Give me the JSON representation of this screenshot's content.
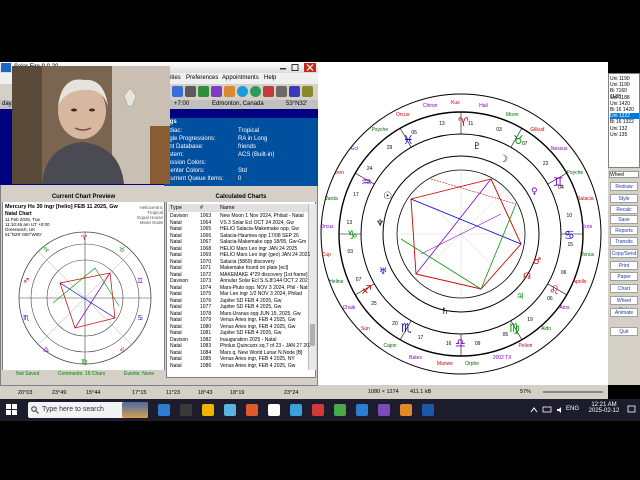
{
  "left_app": {
    "title": "Solar Fire 9.0.20",
    "menus": [
      "File",
      "Chart",
      "Interps",
      "Points",
      "Reports",
      "Utilities",
      "Preferences",
      "Appointments",
      "Help"
    ],
    "visible_menus": [
      "ities",
      "Preferences",
      "Appointments",
      "Help"
    ],
    "info_bar": {
      "day": "day,",
      "time": "+7:00",
      "place": "Edmonton, Canada",
      "coords": "53°N32' 113°"
    },
    "settings_header": "ngs",
    "settings": [
      {
        "label": "odiac:",
        "value": "Tropical"
      },
      {
        "label": "ngle Progressions:",
        "value": "RA in Long"
      },
      {
        "label": "ent Database:",
        "value": "friends"
      },
      {
        "label": "ystem:",
        "value": "ACS (Built-in)"
      },
      {
        "label": "ression Colors:",
        "value": ""
      },
      {
        "label": "Center Colors:",
        "value": "Std"
      },
      {
        "label": "Current Queue Items:",
        "value": "0"
      }
    ]
  },
  "preview": {
    "header": "Current Chart Preview",
    "chart_title": "Mercury Hs 30 ingr [helio] FEB 11 2025, Gw",
    "subtitle": "Natal Chart",
    "details": [
      "11 Feb 2025, Tue",
      "11:10:46 am UT +0:00",
      "Greenwich, UK",
      "51°N29' 000°W00'",
      "Geocentric",
      "Tropical",
      "Koch",
      "Mean Node"
    ],
    "right_details": [
      "Heliocentric",
      "Tropical",
      "Equal House",
      "Mean Node"
    ],
    "status": {
      "not_saved": "Not Saved",
      "comments": "Comments: 15 Chars",
      "events": "Events: None"
    }
  },
  "calculated": {
    "header": "Calculated Charts",
    "col_type": "Type",
    "col_num": "#",
    "col_name": "Name",
    "rows": [
      {
        "type": "Davison",
        "num": "1063",
        "name": "New Moon 1 Nov 2024, Philad - Natal"
      },
      {
        "type": "Natal",
        "num": "1064",
        "name": "VS 3 Solar Ecl OCT 24 2024, Gw"
      },
      {
        "type": "Natal",
        "num": "1065",
        "name": "HELIO Salacia-Makemake opp, Gw"
      },
      {
        "type": "Natal",
        "num": "1066",
        "name": "Salacia-Haumea opp 17/08 SEP 26"
      },
      {
        "type": "Natal",
        "num": "1067",
        "name": "Salacia-Makemake opp 18/05, Gw-Gm"
      },
      {
        "type": "Natal",
        "num": "1068",
        "name": "HELIO Mars Leo ingr JAN 24 2025"
      },
      {
        "type": "Natal",
        "num": "1069",
        "name": "HELIO Mars Leo ingr (geo) JAN 24 2021"
      },
      {
        "type": "Natal",
        "num": "1070",
        "name": "Salacia (5869) discovery"
      },
      {
        "type": "Natal",
        "num": "1071",
        "name": "Makemake found on plate [ecl]"
      },
      {
        "type": "Natal",
        "num": "1072",
        "name": "MAKEMAKE 4*29 discovery [1st frame]"
      },
      {
        "type": "Davison",
        "num": "1073",
        "name": "Annular Solar Ecl S.S.8!144 OCT 2 202"
      },
      {
        "type": "Natal",
        "num": "1074",
        "name": "Mars-Pluto opp. NOV 3 2024, Phil - Nat"
      },
      {
        "type": "Natal",
        "num": "1075",
        "name": "Mar Leo ingr 1/2 NOV 3 2024, Philad"
      },
      {
        "type": "Natal",
        "num": "1076",
        "name": "Jupiter SD FEB 4 2025, Gw"
      },
      {
        "type": "Natal",
        "num": "1077",
        "name": "Jupiter SD FEB 4 2025, Gw"
      },
      {
        "type": "Natal",
        "num": "1078",
        "name": "Mars-Uranus sqq JUN 15, 2025, Gw"
      },
      {
        "type": "Natal",
        "num": "1079",
        "name": "Venus Aries ingr, FEB 4 2025, Gw"
      },
      {
        "type": "Natal",
        "num": "1080",
        "name": "Venus Aries ingr, FEB 4 2025, Gw"
      },
      {
        "type": "Natal",
        "num": "1081",
        "name": "Jupiter SD FEB 4 2025, Gw"
      },
      {
        "type": "Davison",
        "num": "1082",
        "name": "Inauguration 2025 - Natal"
      },
      {
        "type": "Natal",
        "num": "1083",
        "name": "Pholus Quincunx sq.7 of 23 - JAN 27 2025"
      },
      {
        "type": "Natal",
        "num": "1084",
        "name": "Mars q. New World Lunar N.Node [B]"
      },
      {
        "type": "Natal",
        "num": "1085",
        "name": "Venus Aries ingr, FEB 4 2025, NY"
      },
      {
        "type": "Natal",
        "num": "1086",
        "name": "Venus Aries ingr, FEB 4 2025, Gw"
      }
    ]
  },
  "left_status_planets": [
    "20°03",
    "23°49",
    "15°44",
    "17°15",
    "11°23",
    "18°43",
    "18°19",
    "23°24"
  ],
  "chart_window": {
    "bottom": {
      "dims": "1080 × 1274",
      "size": "411.1 kB",
      "zoom": "57%"
    },
    "outer_labels": [
      "Kus",
      "Hail",
      "Moon",
      "Gilkud",
      "Nessus",
      "Psyche",
      "Salacia",
      "Eros",
      "Venus",
      "Apollo",
      "Atos",
      "Aido",
      "Pelion",
      "2002 TX",
      "Orphe",
      "Manwe",
      "Bates",
      "Cajon",
      "Sun",
      "Chaik",
      "Heline",
      "Cup",
      "Orcus",
      "Varda",
      "Iron",
      "Ecl",
      "Psyche",
      "Orcus",
      "Chiron"
    ],
    "degrees": [
      "11",
      "03",
      "07",
      "22",
      "04",
      "10",
      "15",
      "06",
      "06",
      "19",
      "05",
      "09",
      "16",
      "17",
      "20",
      "25",
      "07",
      "03",
      "13",
      "17",
      "24",
      "29",
      "05",
      "13"
    ]
  },
  "right_panel": {
    "list": [
      "Uni 1190",
      "Uni 1190",
      "Bi 7160 1188",
      "Uni 1188",
      "Uni 1420",
      "Bi 16 1420",
      "Uni 1322",
      "Bi 16 1322",
      "Uni 132",
      "Uni 135"
    ],
    "selected_index": 6,
    "wheel_label": "Wheel",
    "buttons": [
      "Redraw",
      "Style",
      "Recalc",
      "Save",
      "Reports",
      "Transits",
      "Copy/Send",
      "Print",
      "Paper",
      "Chart",
      "Wheel Style",
      "Animate",
      "Quit"
    ]
  },
  "taskbar": {
    "search_placeholder": "Type here to search",
    "language": "ENG",
    "time": "12:21 AM",
    "date": "2025-02-12"
  },
  "colors": {
    "accent_blue": "#000080",
    "red": "#d00000",
    "purple": "#7a00cc",
    "green": "#009900"
  }
}
